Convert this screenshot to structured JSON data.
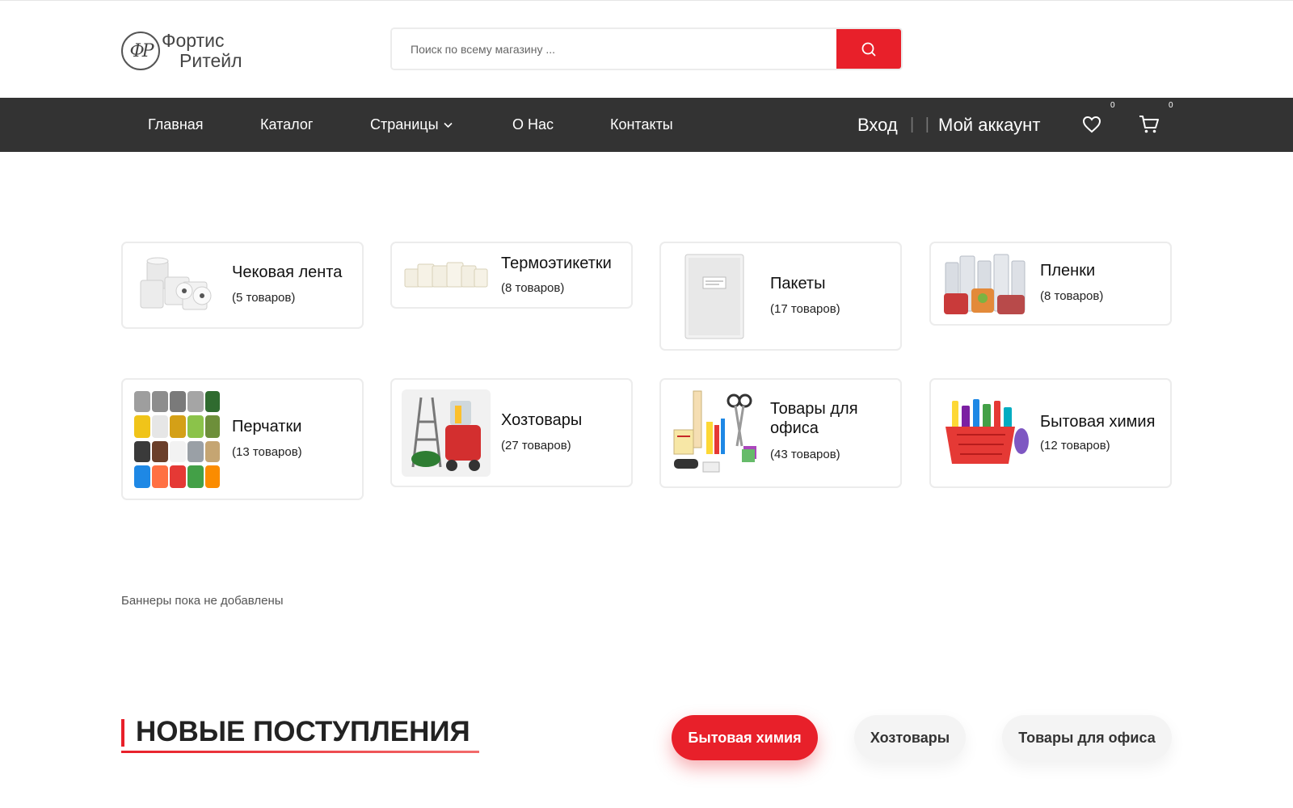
{
  "brand": {
    "line1": "Фортис",
    "line2": "Ритейл",
    "mark": "ФР"
  },
  "search": {
    "placeholder": "Поиск по всему магазину ..."
  },
  "nav": {
    "items": [
      "Главная",
      "Каталог",
      "Страницы",
      "О Нас",
      "Контакты"
    ],
    "login": "Вход",
    "separator": "| |",
    "account": "Мой аккаунт",
    "wishlist_count": "0",
    "cart_count": "0"
  },
  "categories": [
    {
      "title": "Чековая лента",
      "count": "(5 товаров)",
      "icon": "paper-rolls-icon"
    },
    {
      "title": "Термоэтикетки",
      "count": "(8 товаров)",
      "icon": "label-rolls-icon"
    },
    {
      "title": "Пакеты",
      "count": "(17 товаров)",
      "icon": "bag-icon"
    },
    {
      "title": "Пленки",
      "count": "(8 товаров)",
      "icon": "film-rolls-icon"
    },
    {
      "title": "Перчатки",
      "count": "(13 товаров)",
      "icon": "gloves-icon"
    },
    {
      "title": "Хозтовары",
      "count": "(27 товаров)",
      "icon": "household-icon"
    },
    {
      "title": "Товары для офиса",
      "count": "(43 товаров)",
      "icon": "office-supplies-icon"
    },
    {
      "title": "Бытовая химия",
      "count": "(12 товаров)",
      "icon": "cleaning-basket-icon"
    }
  ],
  "banners_note": "Баннеры пока не добавлены",
  "new_arrivals": {
    "title": "НОВЫЕ ПОСТУПЛЕНИЯ",
    "tabs": [
      "Бытовая химия",
      "Хозтовары",
      "Товары для офиса"
    ],
    "active_tab": "Бытовая химия"
  },
  "colors": {
    "accent": "#e8202a",
    "nav_bg": "#333333"
  }
}
